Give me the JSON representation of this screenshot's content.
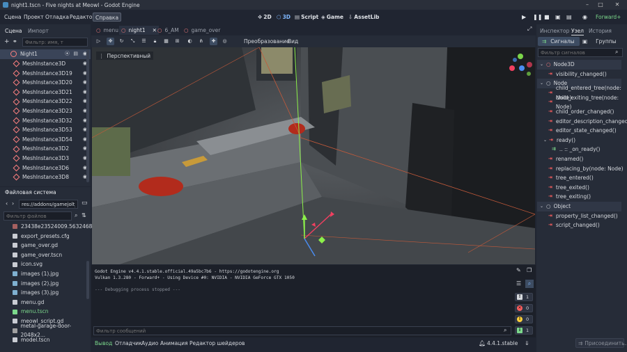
{
  "window": {
    "title": "night1.tscn - Five nights at Meowl - Godot Engine",
    "minimize": "–",
    "maximize": "□",
    "close": "✕"
  },
  "menu": {
    "items": [
      "Сцена",
      "Проект",
      "Отладка",
      "Редактор",
      "Справка"
    ]
  },
  "workspaces": {
    "two_d": "2D",
    "three_d": "3D",
    "script": "Script",
    "game": "Game",
    "assetlib": "AssetLib"
  },
  "renderer": "Forward+",
  "left_tabs": {
    "scene": "Сцена",
    "import": "Импорт"
  },
  "scene_filter_placeholder": "Фильтр: имя, т",
  "scene_tree": {
    "root": "Night1",
    "items": [
      "MeshInstance3D",
      "MeshInstance3D19",
      "MeshInstance3D20",
      "MeshInstance3D21",
      "MeshInstance3D22",
      "MeshInstance3D23",
      "MeshInstance3D32",
      "MeshInstance3D53",
      "MeshInstance3D54",
      "MeshInstance3D2",
      "MeshInstance3D3",
      "MeshInstance3D6",
      "MeshInstance3D8"
    ]
  },
  "filesystem": {
    "title": "Файловая система",
    "path": "res://addons/gamejolt_api",
    "filter_placeholder": "Фильтр файлов",
    "files": [
      "23438e23524009.56324688...",
      "export_presets.cfg",
      "game_over.gd",
      "game_over.tscn",
      "icon.svg",
      "images (1).jpg",
      "images (2).jpg",
      "images (3).jpg",
      "menu.gd",
      "menu.tscn",
      "meowl_script.gd",
      "metal-garage-door-2048x2...",
      "model.tscn"
    ]
  },
  "scene_tabs": [
    "menu",
    "night1",
    "6_AM",
    "game_over"
  ],
  "viewport_toolbar": {
    "transform": "Преобразование",
    "view": "Вид"
  },
  "viewport_label": "Перспективный",
  "output": {
    "lines": [
      "Godot Engine v4.4.1.stable.official.49a5bc7b6 - https://godotengine.org",
      "Vulkan 1.3.280 - Forward+ - Using Device #0: NVIDIA - NVIDIA GeForce GTX 1050",
      "",
      "--- Debugging process stopped ---"
    ],
    "filter_placeholder": "Фильтр сообщений",
    "counts": {
      "messages": "1",
      "errors": "0",
      "warnings": "0",
      "info": "1"
    }
  },
  "bottom_tabs": [
    "Вывод",
    "Отладчик",
    "Аудио",
    "Анимация",
    "Редактор шейдеров"
  ],
  "version": "4.4.1.stable",
  "right_tabs": {
    "inspector": "Инспектор",
    "node": "Узел",
    "history": "История"
  },
  "node_tabs": {
    "signals": "Сигналы",
    "groups": "Группы"
  },
  "signal_filter_placeholder": "Фильтр сигналов",
  "signals": {
    "node3d_section": "Node3D",
    "node3d": [
      "visibility_changed()"
    ],
    "node_section": "Node",
    "node": [
      "child_entered_tree(node: Node)",
      "child_exiting_tree(node: Node)",
      "child_order_changed()",
      "editor_description_changed(...",
      "editor_state_changed()",
      "ready()",
      ".. :: _on_ready()",
      "renamed()",
      "replacing_by(node: Node)",
      "tree_entered()",
      "tree_exited()",
      "tree_exiting()"
    ],
    "object_section": "Object",
    "object": [
      "property_list_changed()",
      "script_changed()"
    ]
  },
  "connect_button": "Присоединить..."
}
